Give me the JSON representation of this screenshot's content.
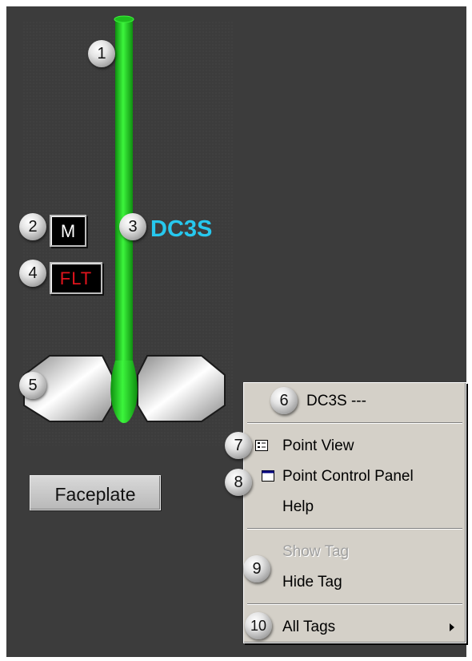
{
  "display": {
    "tag_name": "DC3S",
    "mode_badge": "M",
    "fault_badge": "FLT",
    "faceplate_button": "Faceplate",
    "colors": {
      "pipe": "#22cc22",
      "tag_name": "#27c8ee",
      "fault_text": "#e0141c",
      "background": "#3c3c3c"
    }
  },
  "context_menu": {
    "header": "DC3S ---",
    "point_view": "Point View",
    "point_control_panel": "Point Control Panel",
    "help": "Help",
    "show_tag": "Show Tag",
    "hide_tag": "Hide Tag",
    "all_tags": "All Tags"
  },
  "callouts": [
    "1",
    "2",
    "3",
    "4",
    "5",
    "6",
    "7",
    "8",
    "9",
    "10"
  ]
}
